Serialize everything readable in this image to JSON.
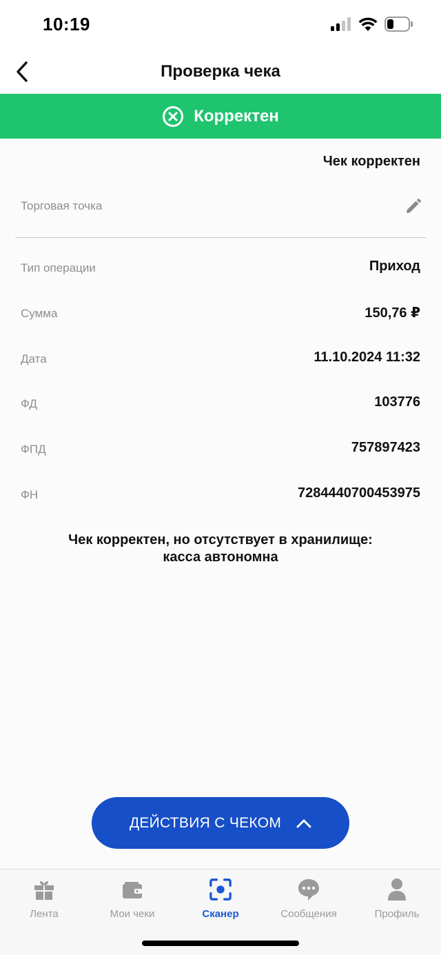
{
  "status_bar": {
    "time": "10:19"
  },
  "nav": {
    "title": "Проверка чека"
  },
  "banner": {
    "text": "Корректен",
    "color": "#1ec46e",
    "icon": "x-circle-icon"
  },
  "summary": {
    "text": "Чек корректен"
  },
  "store": {
    "label": "Торговая точка"
  },
  "rows": [
    {
      "label": "Тип операции",
      "value": "Приход"
    },
    {
      "label": "Сумма",
      "value": "150,76 ₽"
    },
    {
      "label": "Дата",
      "value": "11.10.2024 11:32"
    },
    {
      "label": "ФД",
      "value": "103776"
    },
    {
      "label": "ФПД",
      "value": "757897423"
    },
    {
      "label": "ФН",
      "value": "7284440700453975"
    }
  ],
  "note": {
    "line1": "Чек корректен, но отсутствует в хранилище:",
    "line2": "касса автономна"
  },
  "actions": {
    "label": "ДЕЙСТВИЯ С ЧЕКОМ",
    "color": "#164fc7"
  },
  "tabs": [
    {
      "label": "Лента",
      "icon": "gift-icon",
      "active": false
    },
    {
      "label": "Мои чеки",
      "icon": "wallet-icon",
      "active": false
    },
    {
      "label": "Сканер",
      "icon": "scanner-icon",
      "active": true
    },
    {
      "label": "Сообщения",
      "icon": "chat-icon",
      "active": false
    },
    {
      "label": "Профиль",
      "icon": "profile-icon",
      "active": false
    }
  ]
}
